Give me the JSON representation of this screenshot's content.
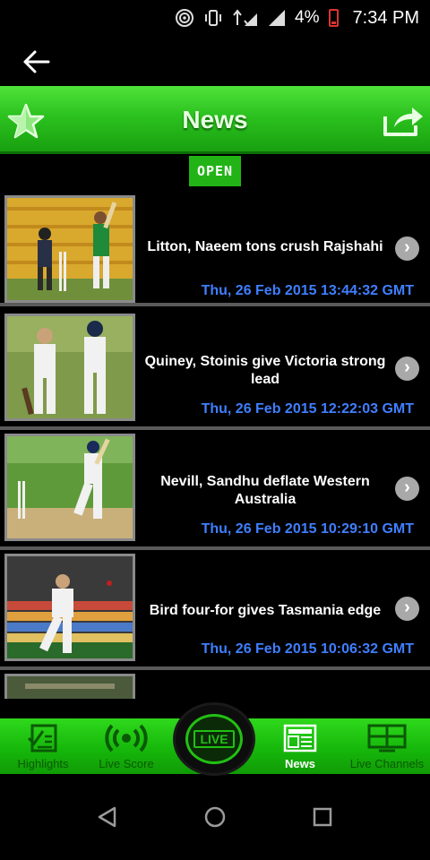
{
  "status_bar": {
    "battery": "4%",
    "time": "7:34 PM",
    "icons": [
      "hotspot-icon",
      "vibrate-icon",
      "data-hplus-icon",
      "signal-icon",
      "signal-icon",
      "battery-low-icon"
    ]
  },
  "header": {
    "title": "News",
    "back_icon": "arrow-left-icon",
    "favorite_icon": "star-icon",
    "share_icon": "share-icon"
  },
  "open_tab": {
    "label": "OPEN"
  },
  "news": [
    {
      "title": "Litton, Naeem tons crush Rajshahi",
      "date": "Thu, 26 Feb 2015 13:44:32 GMT"
    },
    {
      "title": "Quiney, Stoinis give Victoria strong lead",
      "date": "Thu, 26 Feb 2015 12:22:03 GMT"
    },
    {
      "title": "Nevill, Sandhu deflate Western Australia",
      "date": "Thu, 26 Feb 2015 10:29:10 GMT"
    },
    {
      "title": "Bird four-for gives Tasmania edge",
      "date": "Thu, 26 Feb 2015 10:06:32 GMT"
    }
  ],
  "bottom_nav": {
    "items": [
      {
        "label": "Highlights",
        "icon": "highlights-icon"
      },
      {
        "label": "Live Score",
        "icon": "broadcast-icon"
      },
      {
        "label": "News",
        "icon": "newspaper-icon",
        "active": true
      },
      {
        "label": "Live Channels",
        "icon": "tv-icon"
      }
    ],
    "center": {
      "label": "LIVE"
    }
  },
  "colors": {
    "accent_green": "#22c014",
    "date_blue": "#3f7fff"
  }
}
